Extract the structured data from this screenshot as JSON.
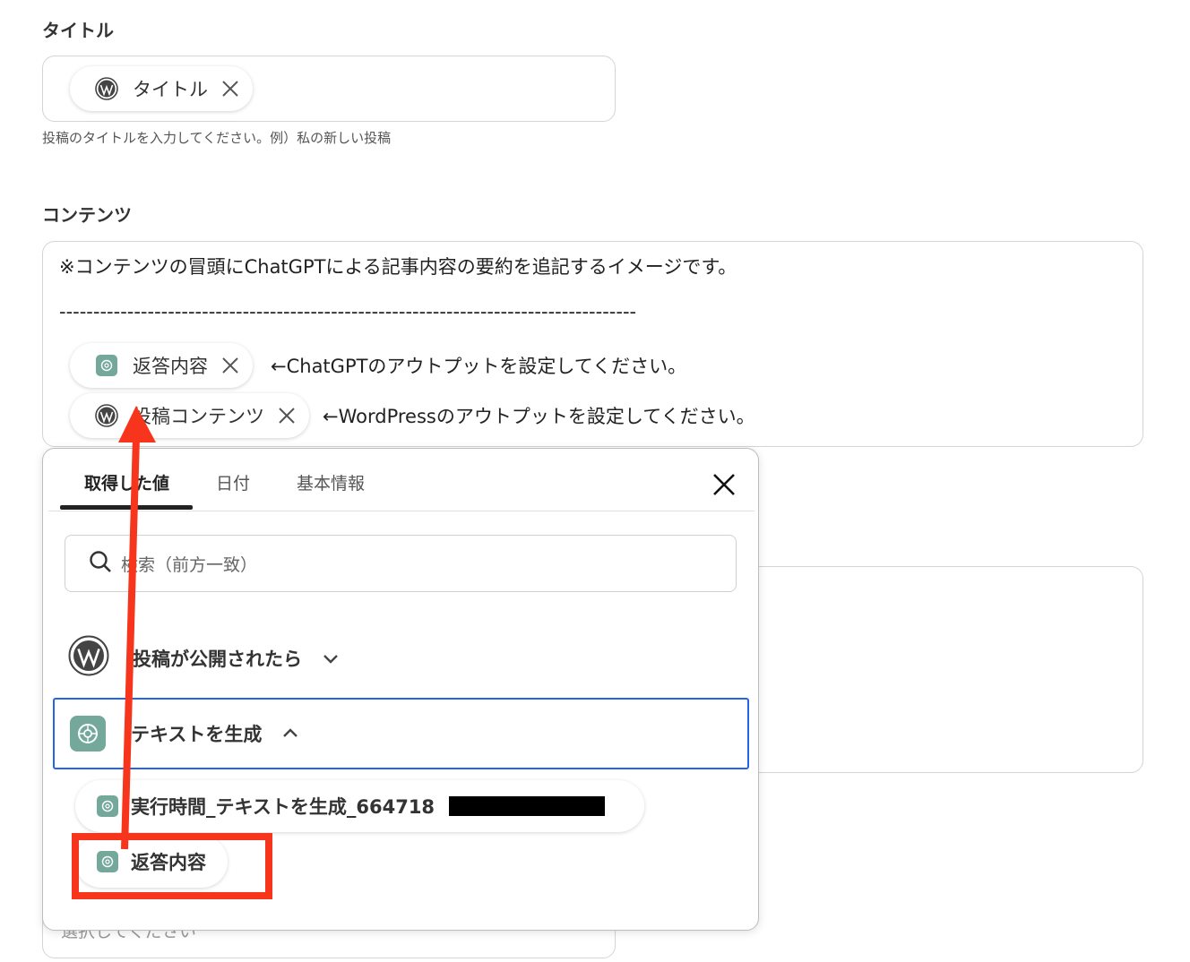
{
  "title_section": {
    "label": "タイトル",
    "chip_label": "タイトル",
    "help": "投稿のタイトルを入力してください。例）私の新しい投稿"
  },
  "content_section": {
    "label": "コンテンツ",
    "intro": "※コンテンツの冒頭にChatGPTによる記事内容の要約を追記するイメージです。",
    "divider": "-------------------------------------------------------------------------------------",
    "chip1_label": "返答内容",
    "chip1_note": "←ChatGPTのアウトプットを設定してください。",
    "chip2_label": "投稿コンテンツ",
    "chip2_note": "←WordPressのアウトプットを設定してください。"
  },
  "bottom_field": {
    "placeholder": "選択してください"
  },
  "popup": {
    "tabs": [
      "取得した値",
      "日付",
      "基本情報"
    ],
    "active_tab": 0,
    "search_placeholder": "検索（前方一致）",
    "sections": [
      {
        "label": "投稿が公開されたら",
        "icon": "wordpress-icon",
        "expanded": false
      },
      {
        "label": "テキストを生成",
        "icon": "chatgpt-icon",
        "expanded": true
      }
    ],
    "items": [
      {
        "label": "実行時間_テキストを生成_664718"
      },
      {
        "label": "返答内容"
      }
    ]
  },
  "colors": {
    "annotation_red": "#f7341c",
    "chatgpt_green": "#74a89a",
    "selected_border": "#2563eb",
    "tab_underline": "#222222"
  }
}
